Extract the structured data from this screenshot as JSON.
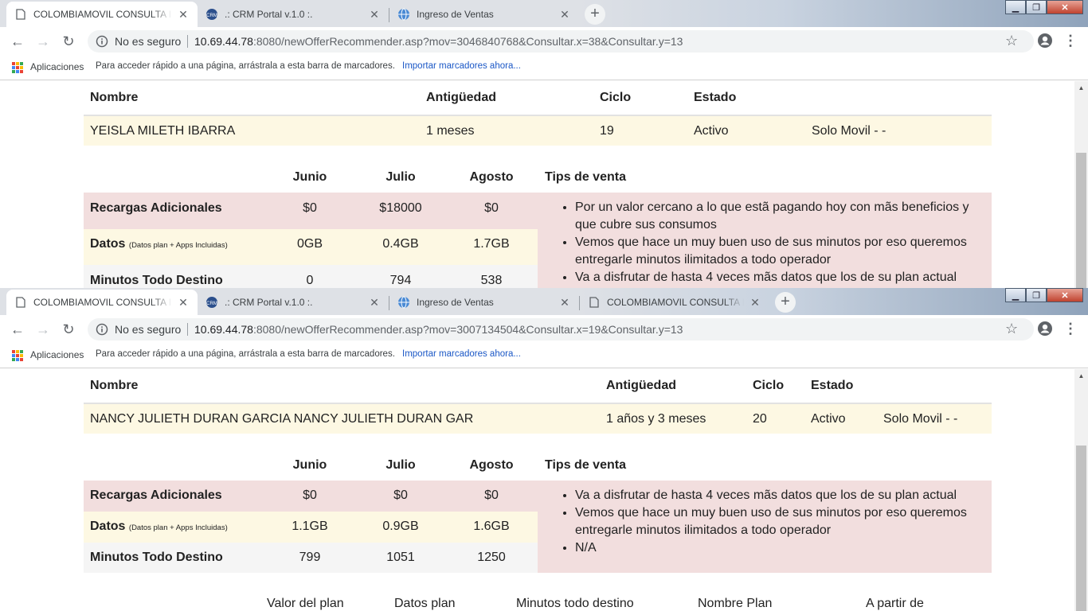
{
  "window1": {
    "tabs": [
      {
        "title": "COLOMBIAMOVIL CONSULTA INDIVIDUAL",
        "icon": "page-icon",
        "active": true
      },
      {
        "title": ".: CRM Portal v.1.0 :.",
        "icon": "crm-logo-icon",
        "active": false
      },
      {
        "title": "Ingreso de Ventas",
        "icon": "globe-icon",
        "active": false
      }
    ],
    "security_label": "No es seguro",
    "url_host": "10.69.44.78",
    "url_rest": ":8080/newOfferRecommender.asp?mov=3046840768&Consultar.x=38&Consultar.y=13",
    "customer": {
      "headers": [
        "Nombre",
        "Antigüedad",
        "Ciclo",
        "Estado"
      ],
      "name": "YEISLA MILETH IBARRA",
      "tenure": "1 meses",
      "cycle": "19",
      "status": "Activo",
      "plan_type": "Solo Movil - -"
    },
    "months": [
      "Junio",
      "Julio",
      "Agosto"
    ],
    "tips_header": "Tips de venta",
    "metrics": [
      {
        "label": "Recargas Adicionales",
        "note": "",
        "values": [
          "$0",
          "$18000",
          "$0"
        ]
      },
      {
        "label": "Datos",
        "note": "(Datos plan + Apps Incluidas)",
        "values": [
          "0GB",
          "0.4GB",
          "1.7GB"
        ]
      },
      {
        "label": "Minutos Todo Destino",
        "note": "",
        "values": [
          "0",
          "794",
          "538"
        ]
      }
    ],
    "tips": [
      "Por un valor cercano a lo que estã pagando hoy con mãs beneficios y que cubre sus consumos",
      "Vemos que hace un muy buen uso de sus minutos por eso queremos entregarle minutos ilimitados a todo operador",
      "Va a disfrutar de hasta 4 veces mãs datos que los de su plan actual"
    ]
  },
  "window2": {
    "tabs": [
      {
        "title": "COLOMBIAMOVIL CONSULTA INDIVIDUAL",
        "icon": "page-icon",
        "active": true
      },
      {
        "title": ".: CRM Portal v.1.0 :.",
        "icon": "crm-logo-icon",
        "active": false
      },
      {
        "title": "Ingreso de Ventas",
        "icon": "globe-icon",
        "active": false
      },
      {
        "title": "COLOMBIAMOVIL CONSULTA INDIVIDUAL",
        "icon": "page-icon",
        "active": false
      }
    ],
    "security_label": "No es seguro",
    "url_host": "10.69.44.78",
    "url_rest": ":8080/newOfferRecommender.asp?mov=3007134504&Consultar.x=19&Consultar.y=13",
    "customer": {
      "headers": [
        "Nombre",
        "Antigüedad",
        "Ciclo",
        "Estado"
      ],
      "name": "NANCY JULIETH DURAN GARCIA NANCY JULIETH DURAN GAR",
      "tenure": "1 años y 3 meses",
      "cycle": "20",
      "status": "Activo",
      "plan_type": "Solo Movil - -"
    },
    "months": [
      "Junio",
      "Julio",
      "Agosto"
    ],
    "tips_header": "Tips de venta",
    "metrics": [
      {
        "label": "Recargas Adicionales",
        "note": "",
        "values": [
          "$0",
          "$0",
          "$0"
        ]
      },
      {
        "label": "Datos",
        "note": "(Datos plan + Apps Incluidas)",
        "values": [
          "1.1GB",
          "0.9GB",
          "1.6GB"
        ]
      },
      {
        "label": "Minutos Todo Destino",
        "note": "",
        "values": [
          "799",
          "1051",
          "1250"
        ]
      }
    ],
    "tips": [
      "Va a disfrutar de hasta 4 veces mãs datos que los de su plan actual",
      "Vemos que hace un muy buen uso de sus minutos por eso queremos entregarle minutos ilimitados a todo operador",
      "N/A"
    ],
    "plan_headers": [
      "Valor del plan",
      "Datos plan",
      "Minutos todo destino",
      "Nombre Plan",
      "A partir de"
    ]
  },
  "bookmarks": {
    "apps_label": "Aplicaciones",
    "hint": "Para acceder rápido a una página, arrástrala a esta barra de marcadores.",
    "import_link": "Importar marcadores ahora..."
  },
  "colors": {
    "pink_row": "#f2dede",
    "yellow_row": "#fdf8e3",
    "grey_row": "#f5f5f5",
    "link": "#1a57c6"
  }
}
